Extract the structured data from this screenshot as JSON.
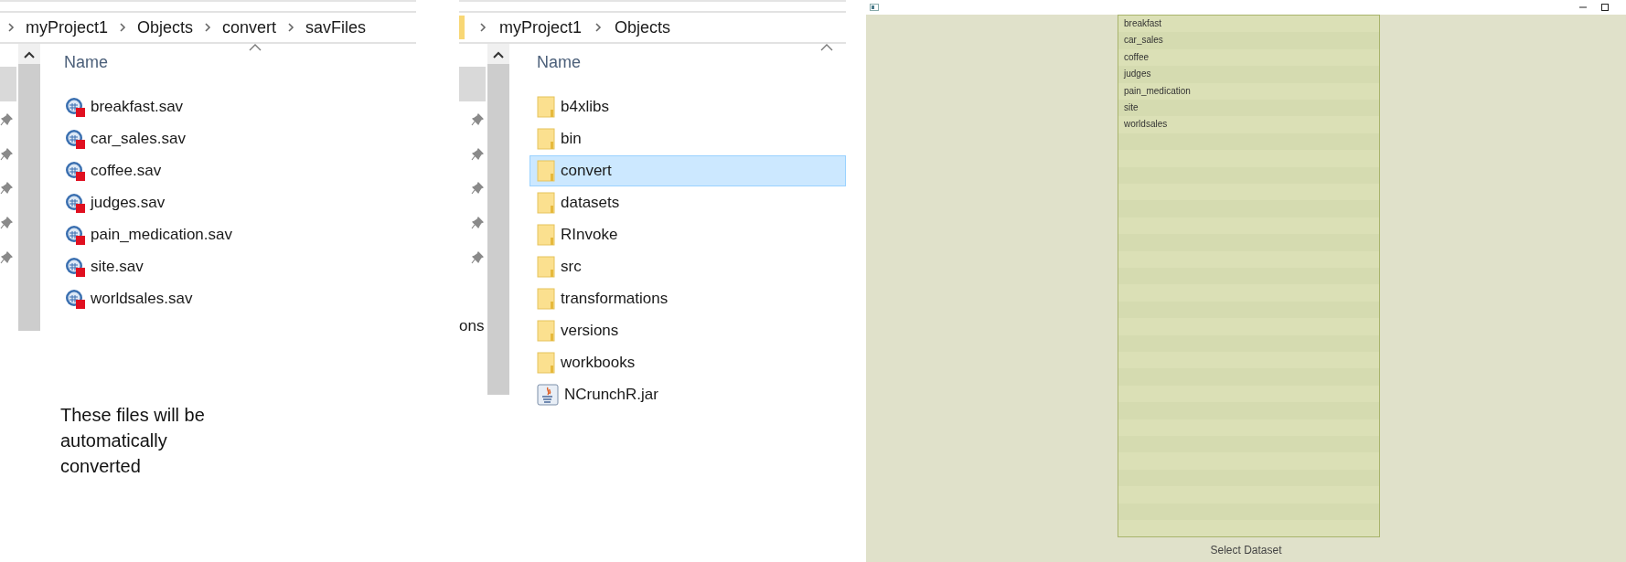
{
  "explorers": [
    {
      "breadcrumb": [
        "myProject1",
        "Objects",
        "convert",
        "savFiles"
      ],
      "column": "Name",
      "items": [
        {
          "name": "breakfast.sav",
          "kind": "sav",
          "selected": false
        },
        {
          "name": "car_sales.sav",
          "kind": "sav",
          "selected": false
        },
        {
          "name": "coffee.sav",
          "kind": "sav",
          "selected": false
        },
        {
          "name": "judges.sav",
          "kind": "sav",
          "selected": false
        },
        {
          "name": "pain_medication.sav",
          "kind": "sav",
          "selected": false
        },
        {
          "name": "site.sav",
          "kind": "sav",
          "selected": false
        },
        {
          "name": "worldsales.sav",
          "kind": "sav",
          "selected": false
        }
      ]
    },
    {
      "breadcrumb": [
        "myProject1",
        "Objects"
      ],
      "column": "Name",
      "nav_text": "ons",
      "items": [
        {
          "name": "b4xlibs",
          "kind": "folder",
          "selected": false
        },
        {
          "name": "bin",
          "kind": "folder",
          "selected": false
        },
        {
          "name": "convert",
          "kind": "folder",
          "selected": true
        },
        {
          "name": "datasets",
          "kind": "folder",
          "selected": false
        },
        {
          "name": "RInvoke",
          "kind": "folder",
          "selected": false
        },
        {
          "name": "src",
          "kind": "folder",
          "selected": false
        },
        {
          "name": "transformations",
          "kind": "folder",
          "selected": false
        },
        {
          "name": "versions",
          "kind": "folder",
          "selected": false
        },
        {
          "name": "workbooks",
          "kind": "folder",
          "selected": false
        },
        {
          "name": "NCrunchR.jar",
          "kind": "jar",
          "selected": false
        }
      ]
    }
  ],
  "note": "These files will be automatically converted",
  "app": {
    "datasets": [
      {
        "name": "breakfast",
        "selected": false
      },
      {
        "name": "car_sales",
        "selected": false
      },
      {
        "name": "coffee",
        "selected": false
      },
      {
        "name": "judges",
        "selected": false
      },
      {
        "name": "pain_medication",
        "selected": false
      },
      {
        "name": "site",
        "selected": false
      },
      {
        "name": "worldsales",
        "selected": false
      }
    ],
    "footer": "Select Dataset"
  }
}
